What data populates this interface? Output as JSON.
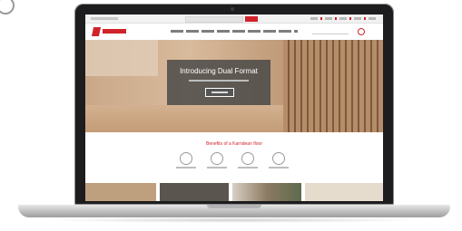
{
  "hero": {
    "title": "Introducing Dual Format"
  },
  "benefits": {
    "title": "Benefits of a Karndean floor"
  },
  "colors": {
    "brand_red": "#d1232a",
    "hero_card": "#464646",
    "laptop_bezel": "#1d1d1f",
    "wood_light": "#d8bb9c",
    "wood_dark": "#7c5a3e"
  },
  "icons": [
    "logo-mark",
    "search-icon",
    "basket-icon",
    "benefit-icon"
  ]
}
